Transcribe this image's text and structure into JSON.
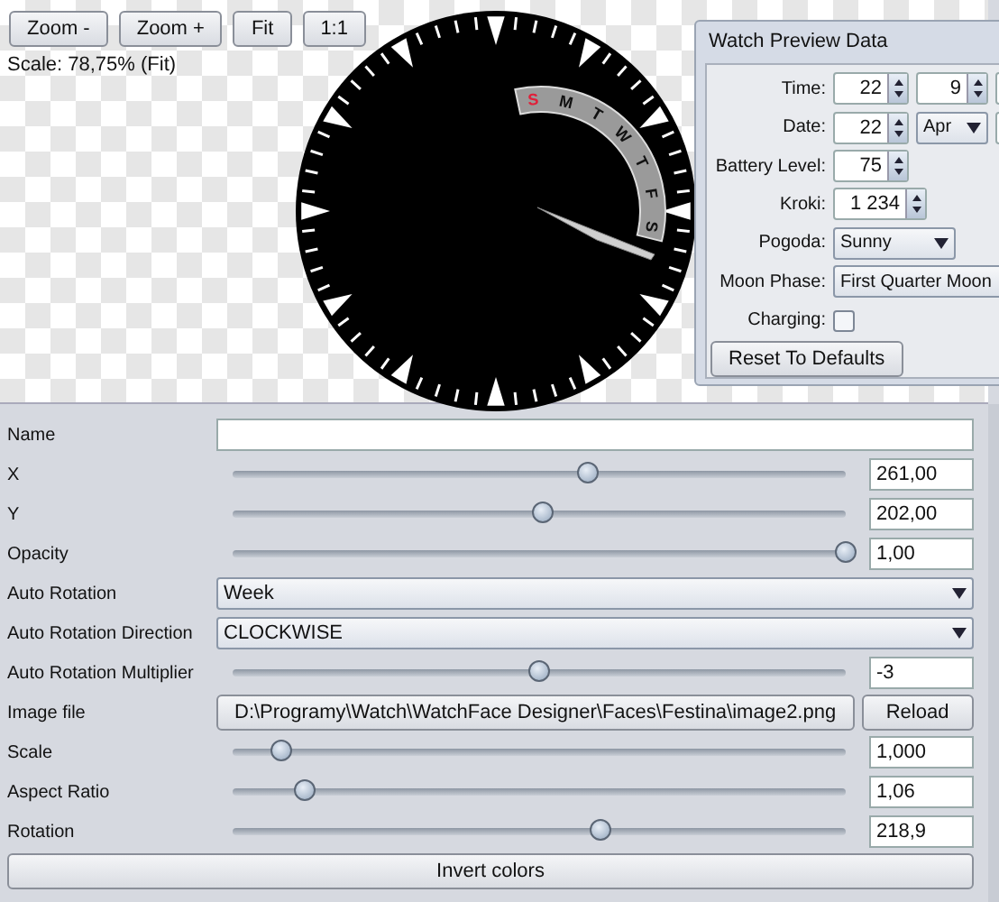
{
  "preview": {
    "buttons": [
      "Zoom -",
      "Zoom +",
      "Fit",
      "1:1"
    ],
    "scale_label": "Scale:  78,75%  (Fit)",
    "week_days": [
      {
        "label": "S",
        "selected": true
      },
      {
        "label": "M",
        "selected": false
      },
      {
        "label": "T",
        "selected": false
      },
      {
        "label": "W",
        "selected": false
      },
      {
        "label": "T",
        "selected": false
      },
      {
        "label": "F",
        "selected": false
      },
      {
        "label": "S",
        "selected": false
      }
    ]
  },
  "watch_preview_data": {
    "title": "Watch Preview Data",
    "fields": [
      {
        "kind": "spinners",
        "label": "Time:",
        "values": [
          "22",
          "9"
        ]
      },
      {
        "kind": "date",
        "label": "Date:",
        "day": "22",
        "month": "Apr"
      },
      {
        "kind": "spinner",
        "label": "Battery Level:",
        "value": "75"
      },
      {
        "kind": "wide_spinner",
        "label": "Kroki:",
        "value": "1 234"
      },
      {
        "kind": "combo",
        "label": "Pogoda:",
        "value": "Sunny"
      },
      {
        "kind": "wide_combo",
        "label": "Moon Phase:",
        "value": "First Quarter Moon"
      },
      {
        "kind": "checkbox",
        "label": "Charging:",
        "checked": false
      }
    ],
    "reset_button": "Reset To Defaults"
  },
  "properties": [
    {
      "kind": "text",
      "label": "Name"
    },
    {
      "kind": "slider",
      "label": "X",
      "level": 0.58,
      "value": "261,00"
    },
    {
      "kind": "slider",
      "label": "Y",
      "level": 0.505,
      "value": "202,00"
    },
    {
      "kind": "slider",
      "label": "Opacity",
      "level": 1.0,
      "value": "1,00"
    },
    {
      "kind": "combo",
      "label": "Auto Rotation",
      "value": "Week"
    },
    {
      "kind": "combo",
      "label": "Auto Rotation Direction",
      "value": "CLOCKWISE"
    },
    {
      "kind": "slider",
      "label": "Auto Rotation Multiplier",
      "level": 0.5,
      "value": "-3"
    },
    {
      "kind": "file",
      "label": "Image file",
      "value": "D:\\Programy\\Watch\\WatchFace Designer\\Faces\\Festina\\image2.png",
      "button": "Reload"
    },
    {
      "kind": "slider",
      "label": "Scale",
      "level": 0.08,
      "value": "1,000"
    },
    {
      "kind": "slider",
      "label": "Aspect Ratio",
      "level": 0.118,
      "value": "1,06"
    },
    {
      "kind": "slider",
      "label": "Rotation",
      "level": 0.6,
      "value": "218,9"
    }
  ],
  "invert_button": "Invert colors"
}
